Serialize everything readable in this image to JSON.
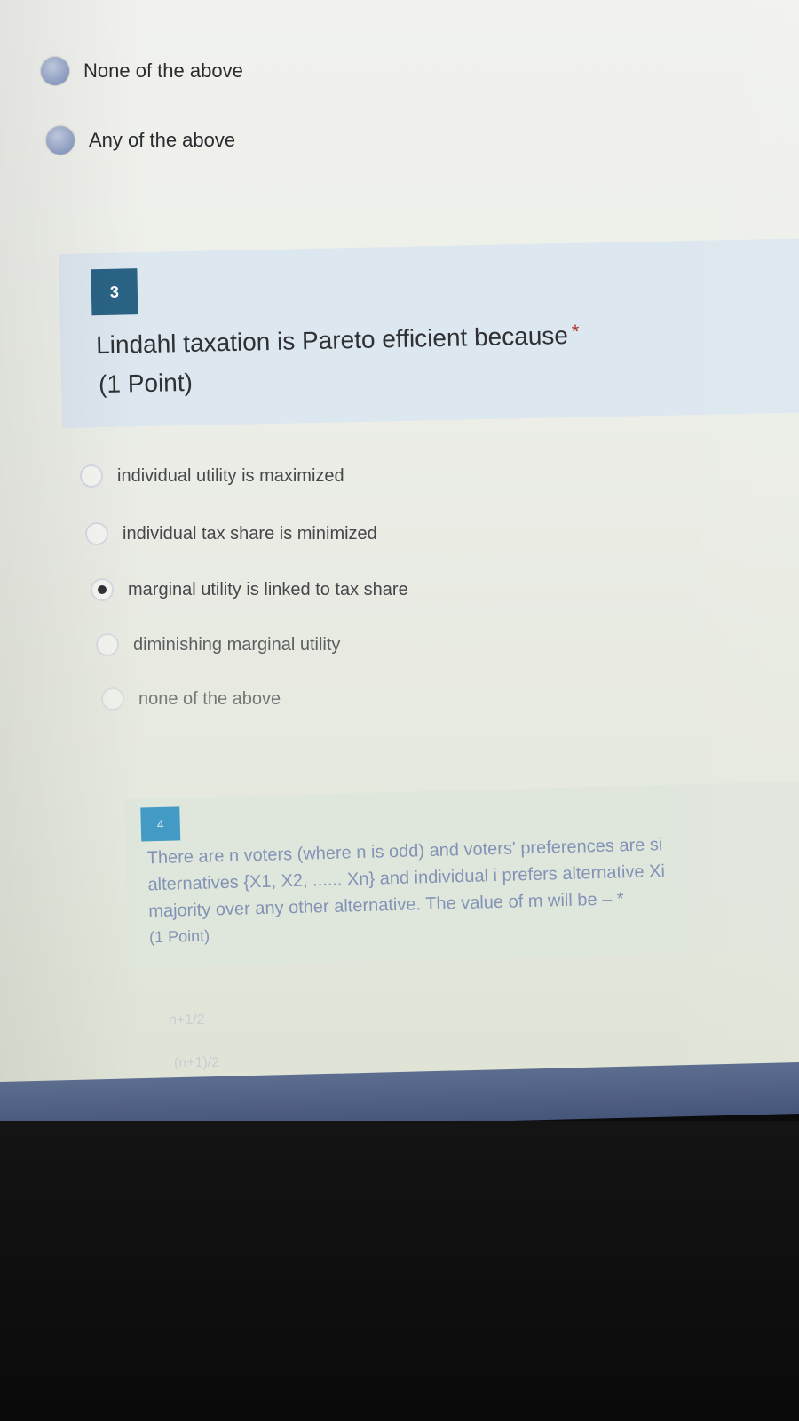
{
  "prev_question": {
    "options": [
      {
        "label": "None of the above",
        "selected": false
      },
      {
        "label": "Any of the above",
        "selected": false
      }
    ]
  },
  "question3": {
    "number": "3",
    "title": "Lindahl taxation is Pareto efficient because",
    "required_mark": "*",
    "points": "(1 Point)",
    "options": [
      {
        "label": "individual utility is maximized",
        "selected": false
      },
      {
        "label": "individual tax share is minimized",
        "selected": false
      },
      {
        "label": "marginal utility is linked to tax share",
        "selected": true
      },
      {
        "label": "diminishing marginal utility",
        "selected": false
      },
      {
        "label": "none of the above",
        "selected": false
      }
    ]
  },
  "question4": {
    "number": "4",
    "lines": [
      "There are n voters (where n is odd) and voters' preferences are si",
      "alternatives {X1, X2, ...... Xn} and individual i prefers alternative Xi",
      "majority over any other alternative. The value of m will be – *"
    ],
    "points": "(1 Point)",
    "answers_faded": [
      "n+1/2",
      "(n+1)/2"
    ]
  },
  "colors": {
    "accent_badge": "#2a6384",
    "radio_fill": "#8f9fc4",
    "card_bg": "#dde7ef",
    "taskbar": "#4f5f84"
  }
}
